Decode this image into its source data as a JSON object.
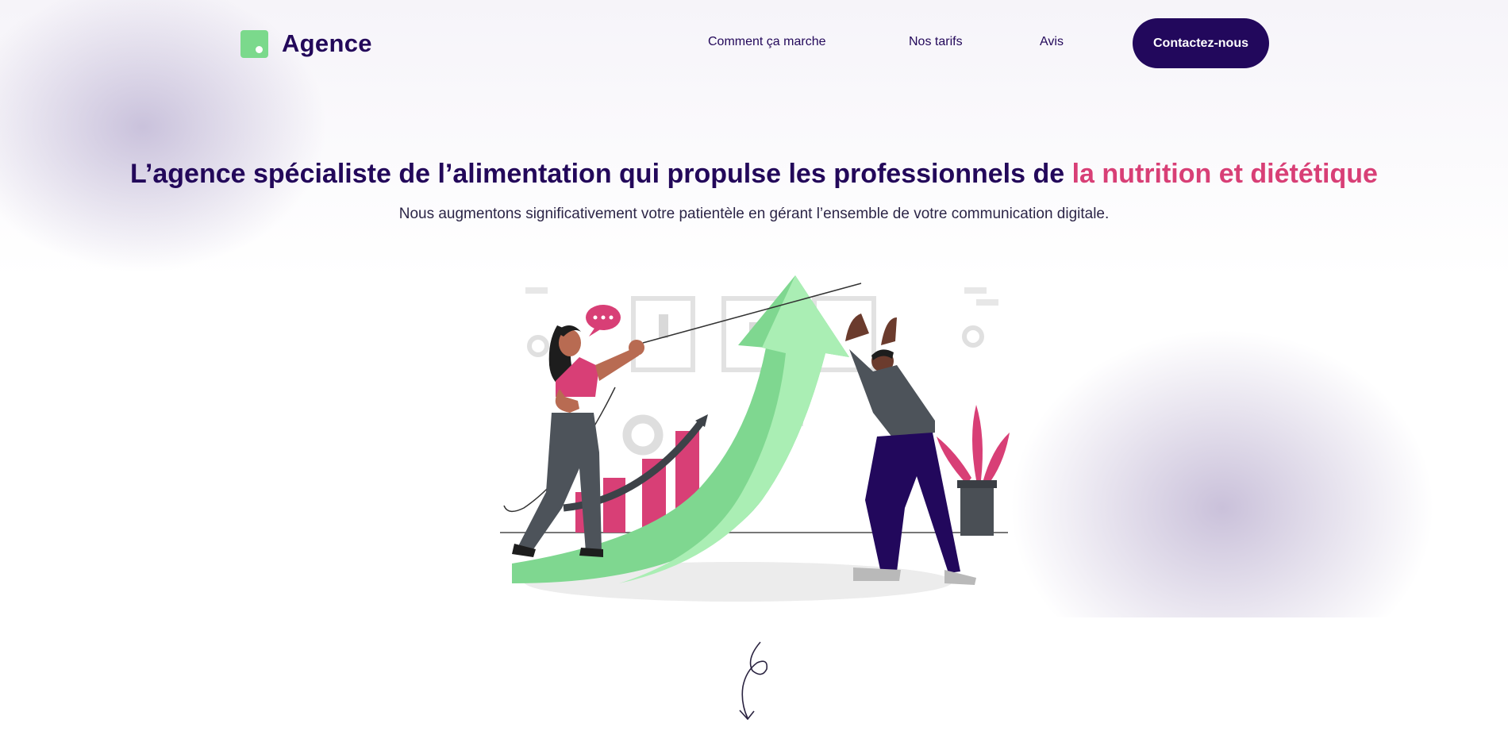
{
  "header": {
    "brand": "Agence",
    "nav": [
      {
        "label": "Comment ça marche"
      },
      {
        "label": "Nos tarifs"
      },
      {
        "label": "Avis"
      }
    ],
    "cta_label": "Contactez-nous"
  },
  "hero": {
    "title_main": "L’agence spécialiste de l’alimentation qui propulse les professionnels de ",
    "title_accent": "la nutrition et diététique",
    "subtitle": "Nous augmentons significativement votre patientèle en gérant l’ensemble de votre communication digitale."
  },
  "colors": {
    "primary": "#23085a",
    "accent": "#d83f76",
    "green": "#7bd98c"
  },
  "icons": {
    "logo": "logo-mark-icon",
    "scroll": "scroll-down-arrow-icon"
  }
}
